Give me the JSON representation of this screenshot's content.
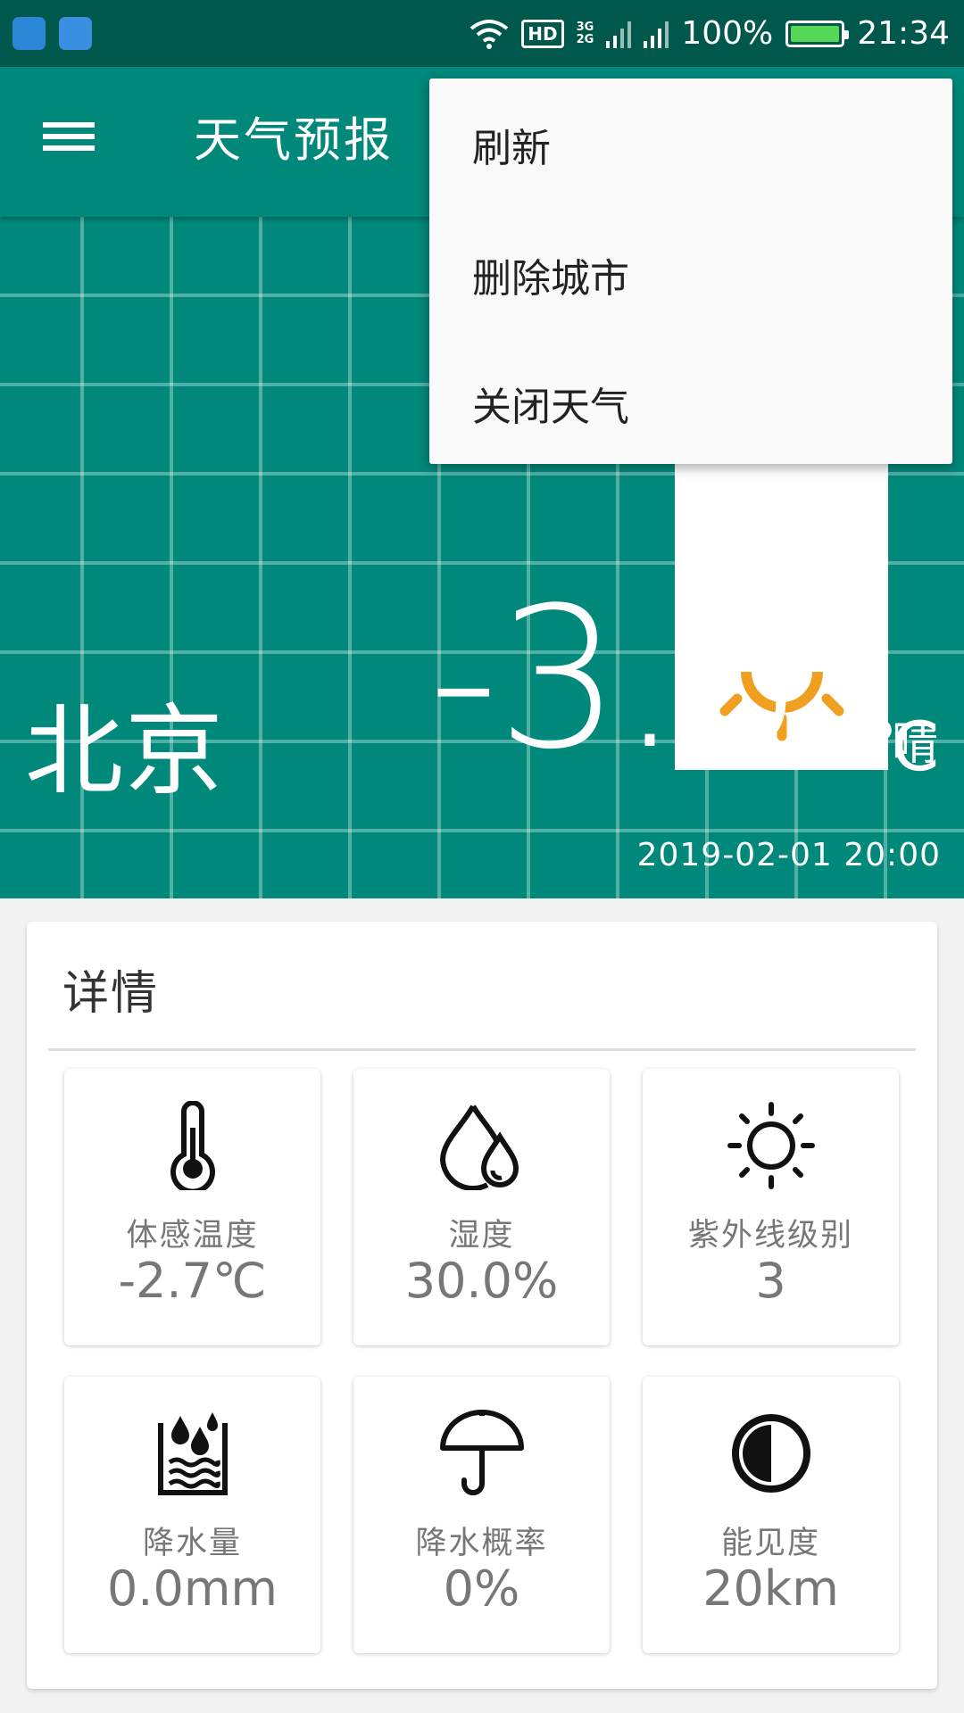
{
  "status_bar": {
    "battery": "100%",
    "time": "21:34",
    "hd": "HD",
    "net_3g": "3G",
    "net_2g": "2G"
  },
  "toolbar": {
    "title": "天气预报"
  },
  "menu": {
    "items": [
      "刷新",
      "删除城市",
      "关闭天气"
    ]
  },
  "weather": {
    "city": "北京",
    "temperature": "-3.6",
    "unit": "℃",
    "condition": "晴",
    "updated": "2019-02-01 20:00"
  },
  "details": {
    "title": "详情",
    "items": [
      {
        "icon": "thermometer-icon",
        "label": "体感温度",
        "value": "-2.7℃"
      },
      {
        "icon": "water-drops-icon",
        "label": "湿度",
        "value": "30.0%"
      },
      {
        "icon": "sun-icon",
        "label": "紫外线级别",
        "value": "3"
      },
      {
        "icon": "rain-gauge-icon",
        "label": "降水量",
        "value": "0.0mm"
      },
      {
        "icon": "umbrella-icon",
        "label": "降水概率",
        "value": "0%"
      },
      {
        "icon": "contrast-icon",
        "label": "能见度",
        "value": "20km"
      }
    ]
  },
  "colors": {
    "primary": "#00897b",
    "status_bar": "#00574b",
    "sun": "#f0a020"
  }
}
